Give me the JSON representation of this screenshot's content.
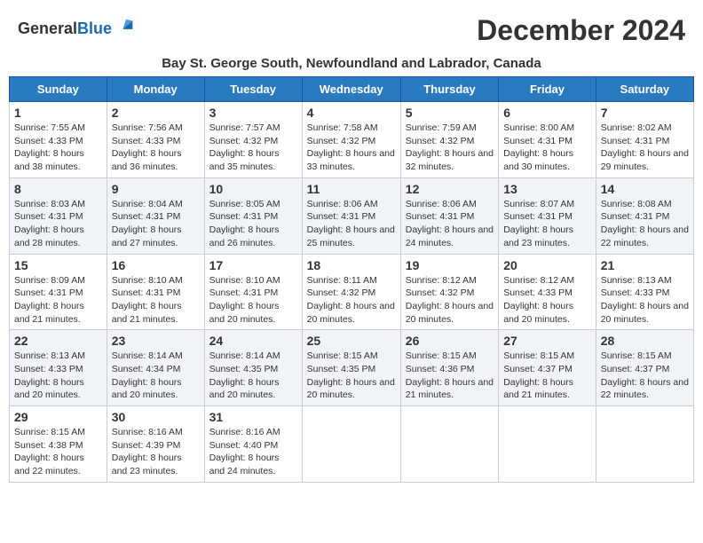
{
  "logo": {
    "general": "General",
    "blue": "Blue"
  },
  "title": "December 2024",
  "subtitle": "Bay St. George South, Newfoundland and Labrador, Canada",
  "weekdays": [
    "Sunday",
    "Monday",
    "Tuesday",
    "Wednesday",
    "Thursday",
    "Friday",
    "Saturday"
  ],
  "weeks": [
    [
      {
        "day": "1",
        "sunrise": "Sunrise: 7:55 AM",
        "sunset": "Sunset: 4:33 PM",
        "daylight": "Daylight: 8 hours and 38 minutes."
      },
      {
        "day": "2",
        "sunrise": "Sunrise: 7:56 AM",
        "sunset": "Sunset: 4:33 PM",
        "daylight": "Daylight: 8 hours and 36 minutes."
      },
      {
        "day": "3",
        "sunrise": "Sunrise: 7:57 AM",
        "sunset": "Sunset: 4:32 PM",
        "daylight": "Daylight: 8 hours and 35 minutes."
      },
      {
        "day": "4",
        "sunrise": "Sunrise: 7:58 AM",
        "sunset": "Sunset: 4:32 PM",
        "daylight": "Daylight: 8 hours and 33 minutes."
      },
      {
        "day": "5",
        "sunrise": "Sunrise: 7:59 AM",
        "sunset": "Sunset: 4:32 PM",
        "daylight": "Daylight: 8 hours and 32 minutes."
      },
      {
        "day": "6",
        "sunrise": "Sunrise: 8:00 AM",
        "sunset": "Sunset: 4:31 PM",
        "daylight": "Daylight: 8 hours and 30 minutes."
      },
      {
        "day": "7",
        "sunrise": "Sunrise: 8:02 AM",
        "sunset": "Sunset: 4:31 PM",
        "daylight": "Daylight: 8 hours and 29 minutes."
      }
    ],
    [
      {
        "day": "8",
        "sunrise": "Sunrise: 8:03 AM",
        "sunset": "Sunset: 4:31 PM",
        "daylight": "Daylight: 8 hours and 28 minutes."
      },
      {
        "day": "9",
        "sunrise": "Sunrise: 8:04 AM",
        "sunset": "Sunset: 4:31 PM",
        "daylight": "Daylight: 8 hours and 27 minutes."
      },
      {
        "day": "10",
        "sunrise": "Sunrise: 8:05 AM",
        "sunset": "Sunset: 4:31 PM",
        "daylight": "Daylight: 8 hours and 26 minutes."
      },
      {
        "day": "11",
        "sunrise": "Sunrise: 8:06 AM",
        "sunset": "Sunset: 4:31 PM",
        "daylight": "Daylight: 8 hours and 25 minutes."
      },
      {
        "day": "12",
        "sunrise": "Sunrise: 8:06 AM",
        "sunset": "Sunset: 4:31 PM",
        "daylight": "Daylight: 8 hours and 24 minutes."
      },
      {
        "day": "13",
        "sunrise": "Sunrise: 8:07 AM",
        "sunset": "Sunset: 4:31 PM",
        "daylight": "Daylight: 8 hours and 23 minutes."
      },
      {
        "day": "14",
        "sunrise": "Sunrise: 8:08 AM",
        "sunset": "Sunset: 4:31 PM",
        "daylight": "Daylight: 8 hours and 22 minutes."
      }
    ],
    [
      {
        "day": "15",
        "sunrise": "Sunrise: 8:09 AM",
        "sunset": "Sunset: 4:31 PM",
        "daylight": "Daylight: 8 hours and 21 minutes."
      },
      {
        "day": "16",
        "sunrise": "Sunrise: 8:10 AM",
        "sunset": "Sunset: 4:31 PM",
        "daylight": "Daylight: 8 hours and 21 minutes."
      },
      {
        "day": "17",
        "sunrise": "Sunrise: 8:10 AM",
        "sunset": "Sunset: 4:31 PM",
        "daylight": "Daylight: 8 hours and 20 minutes."
      },
      {
        "day": "18",
        "sunrise": "Sunrise: 8:11 AM",
        "sunset": "Sunset: 4:32 PM",
        "daylight": "Daylight: 8 hours and 20 minutes."
      },
      {
        "day": "19",
        "sunrise": "Sunrise: 8:12 AM",
        "sunset": "Sunset: 4:32 PM",
        "daylight": "Daylight: 8 hours and 20 minutes."
      },
      {
        "day": "20",
        "sunrise": "Sunrise: 8:12 AM",
        "sunset": "Sunset: 4:33 PM",
        "daylight": "Daylight: 8 hours and 20 minutes."
      },
      {
        "day": "21",
        "sunrise": "Sunrise: 8:13 AM",
        "sunset": "Sunset: 4:33 PM",
        "daylight": "Daylight: 8 hours and 20 minutes."
      }
    ],
    [
      {
        "day": "22",
        "sunrise": "Sunrise: 8:13 AM",
        "sunset": "Sunset: 4:33 PM",
        "daylight": "Daylight: 8 hours and 20 minutes."
      },
      {
        "day": "23",
        "sunrise": "Sunrise: 8:14 AM",
        "sunset": "Sunset: 4:34 PM",
        "daylight": "Daylight: 8 hours and 20 minutes."
      },
      {
        "day": "24",
        "sunrise": "Sunrise: 8:14 AM",
        "sunset": "Sunset: 4:35 PM",
        "daylight": "Daylight: 8 hours and 20 minutes."
      },
      {
        "day": "25",
        "sunrise": "Sunrise: 8:15 AM",
        "sunset": "Sunset: 4:35 PM",
        "daylight": "Daylight: 8 hours and 20 minutes."
      },
      {
        "day": "26",
        "sunrise": "Sunrise: 8:15 AM",
        "sunset": "Sunset: 4:36 PM",
        "daylight": "Daylight: 8 hours and 21 minutes."
      },
      {
        "day": "27",
        "sunrise": "Sunrise: 8:15 AM",
        "sunset": "Sunset: 4:37 PM",
        "daylight": "Daylight: 8 hours and 21 minutes."
      },
      {
        "day": "28",
        "sunrise": "Sunrise: 8:15 AM",
        "sunset": "Sunset: 4:37 PM",
        "daylight": "Daylight: 8 hours and 22 minutes."
      }
    ],
    [
      {
        "day": "29",
        "sunrise": "Sunrise: 8:15 AM",
        "sunset": "Sunset: 4:38 PM",
        "daylight": "Daylight: 8 hours and 22 minutes."
      },
      {
        "day": "30",
        "sunrise": "Sunrise: 8:16 AM",
        "sunset": "Sunset: 4:39 PM",
        "daylight": "Daylight: 8 hours and 23 minutes."
      },
      {
        "day": "31",
        "sunrise": "Sunrise: 8:16 AM",
        "sunset": "Sunset: 4:40 PM",
        "daylight": "Daylight: 8 hours and 24 minutes."
      },
      null,
      null,
      null,
      null
    ]
  ]
}
